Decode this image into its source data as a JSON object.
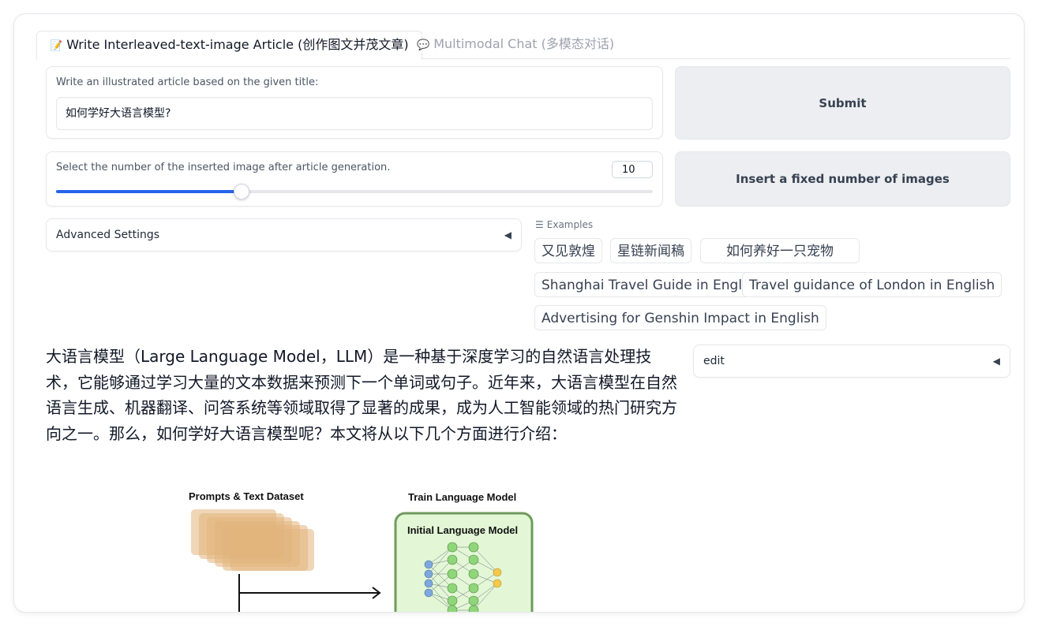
{
  "tabs": [
    {
      "icon": "memo-icon",
      "label": "Write Interleaved-text-image Article (创作图文并茂文章)"
    },
    {
      "icon": "speech-bubble-icon",
      "label": "Multimodal Chat (多模态对话)"
    }
  ],
  "title_input": {
    "label": "Write an illustrated article based on the given title:",
    "value": "如何学好大语言模型?"
  },
  "slider": {
    "label": "Select the number of the inserted image after article generation.",
    "value": "10",
    "fraction": 0.31
  },
  "buttons": {
    "submit": "Submit",
    "insert": "Insert a fixed number of images"
  },
  "advanced": {
    "label": "Advanced Settings",
    "caret": "◀"
  },
  "examples": {
    "header": "Examples",
    "items": [
      "又见敦煌",
      "星链新闻稿",
      "如何养好一只宠物",
      "Shanghai Travel Guide in English",
      "Travel guidance of London in English",
      "Advertising for Genshin Impact in English"
    ]
  },
  "edit": {
    "label": "edit",
    "caret": "◀"
  },
  "article": {
    "text": "大语言模型（Large Language Model，LLM）是一种基于深度学习的自然语言处理技术，它能够通过学习大量的文本数据来预测下一个单词或句子。近年来，大语言模型在自然语言生成、机器翻译、问答系统等领域取得了显著的成果，成为人工智能领域的热门研究方向之一。那么，如何学好大语言模型呢？本文将从以下几个方面进行介绍："
  },
  "figure": {
    "dataset_label": "Prompts & Text Dataset",
    "train_label": "Train Language Model",
    "model_label": "Initial Language Model",
    "colors": {
      "dataset": "#e2b57c",
      "model_fill": "#e3f7d6",
      "model_border": "#6f9a5c",
      "node_green": "#8fd67a",
      "node_blue": "#7ea8dc",
      "node_yellow": "#f5c84c"
    }
  }
}
